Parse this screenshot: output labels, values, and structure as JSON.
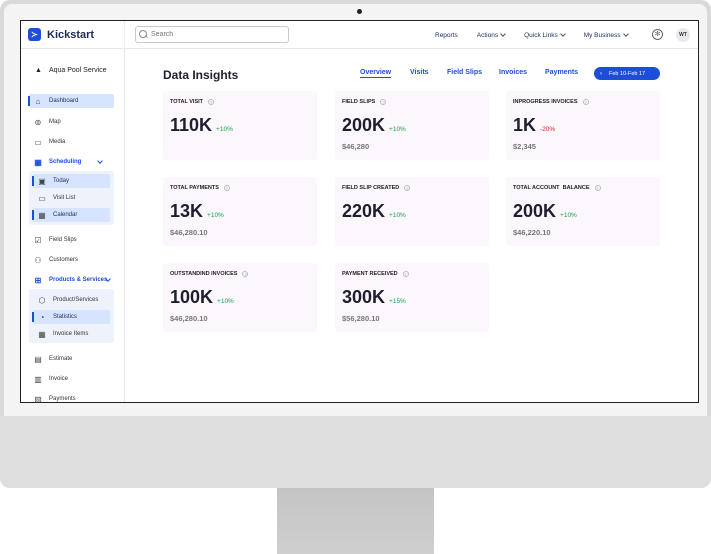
{
  "app": {
    "name": "Kickstart",
    "logo_glyph": "≻"
  },
  "search": {
    "placeholder": "Search"
  },
  "topnav": {
    "reports": "Reports",
    "actions": "Actions",
    "quick_links": "Quick Links",
    "my_business": "My Business",
    "avatar": "WT"
  },
  "sidebar": {
    "business": "Aqua Pool Service",
    "items": {
      "dashboard": "Dashboard",
      "map": "Map",
      "media": "Media",
      "scheduling": "Scheduling",
      "today": "Today",
      "visit_list": "Visit List",
      "calendar": "Calendar",
      "field_slips": "Field Slips",
      "customers": "Customers",
      "products_services": "Products & Services",
      "product_services": "Product/Services",
      "statistics": "Statistics",
      "invoice_items": "Invoice Items",
      "estimate": "Estimate",
      "invoice": "Invoice",
      "payments": "Payments"
    }
  },
  "main": {
    "title": "Data Insights",
    "tabs": {
      "overview": "Overview",
      "visits": "Visits",
      "field_slips": "Field Slips",
      "invoices": "Invoices",
      "payments": "Payments"
    },
    "date_range": "Feb 10-Feb 17"
  },
  "cards": [
    {
      "label": "TOTAL VISIT",
      "value": "110K",
      "delta": "+10%",
      "sub": ""
    },
    {
      "label": "FIELD SLIPS",
      "value": "200K",
      "delta": "+10%",
      "sub": "$46,280"
    },
    {
      "label": "INPROGRESS INVOICES",
      "value": "1K",
      "delta": "-20%",
      "sub": "$2,345"
    },
    {
      "label": "TOTAL PAYMENTS",
      "value": "13K",
      "delta": "+10%",
      "sub": "$46,280.10"
    },
    {
      "label": "FIELD SLIP CREATED",
      "value": "220K",
      "delta": "+10%",
      "sub": ""
    },
    {
      "label": "TOTAL ACCOUNT  BALANCE",
      "value": "200K",
      "delta": "+10%",
      "sub": "$46,220.10"
    },
    {
      "label": "OUTSTANDIND INVOICES",
      "value": "100K",
      "delta": "+10%",
      "sub": "$46,280.10"
    },
    {
      "label": "PAYMENT RECEIVED",
      "value": "300K",
      "delta": "+15%",
      "sub": "$56,280.10"
    }
  ],
  "colors": {
    "accent": "#1d4ed8",
    "card_bg": "#fcf6fd",
    "up": "#16a34a",
    "down": "#dc2626"
  }
}
